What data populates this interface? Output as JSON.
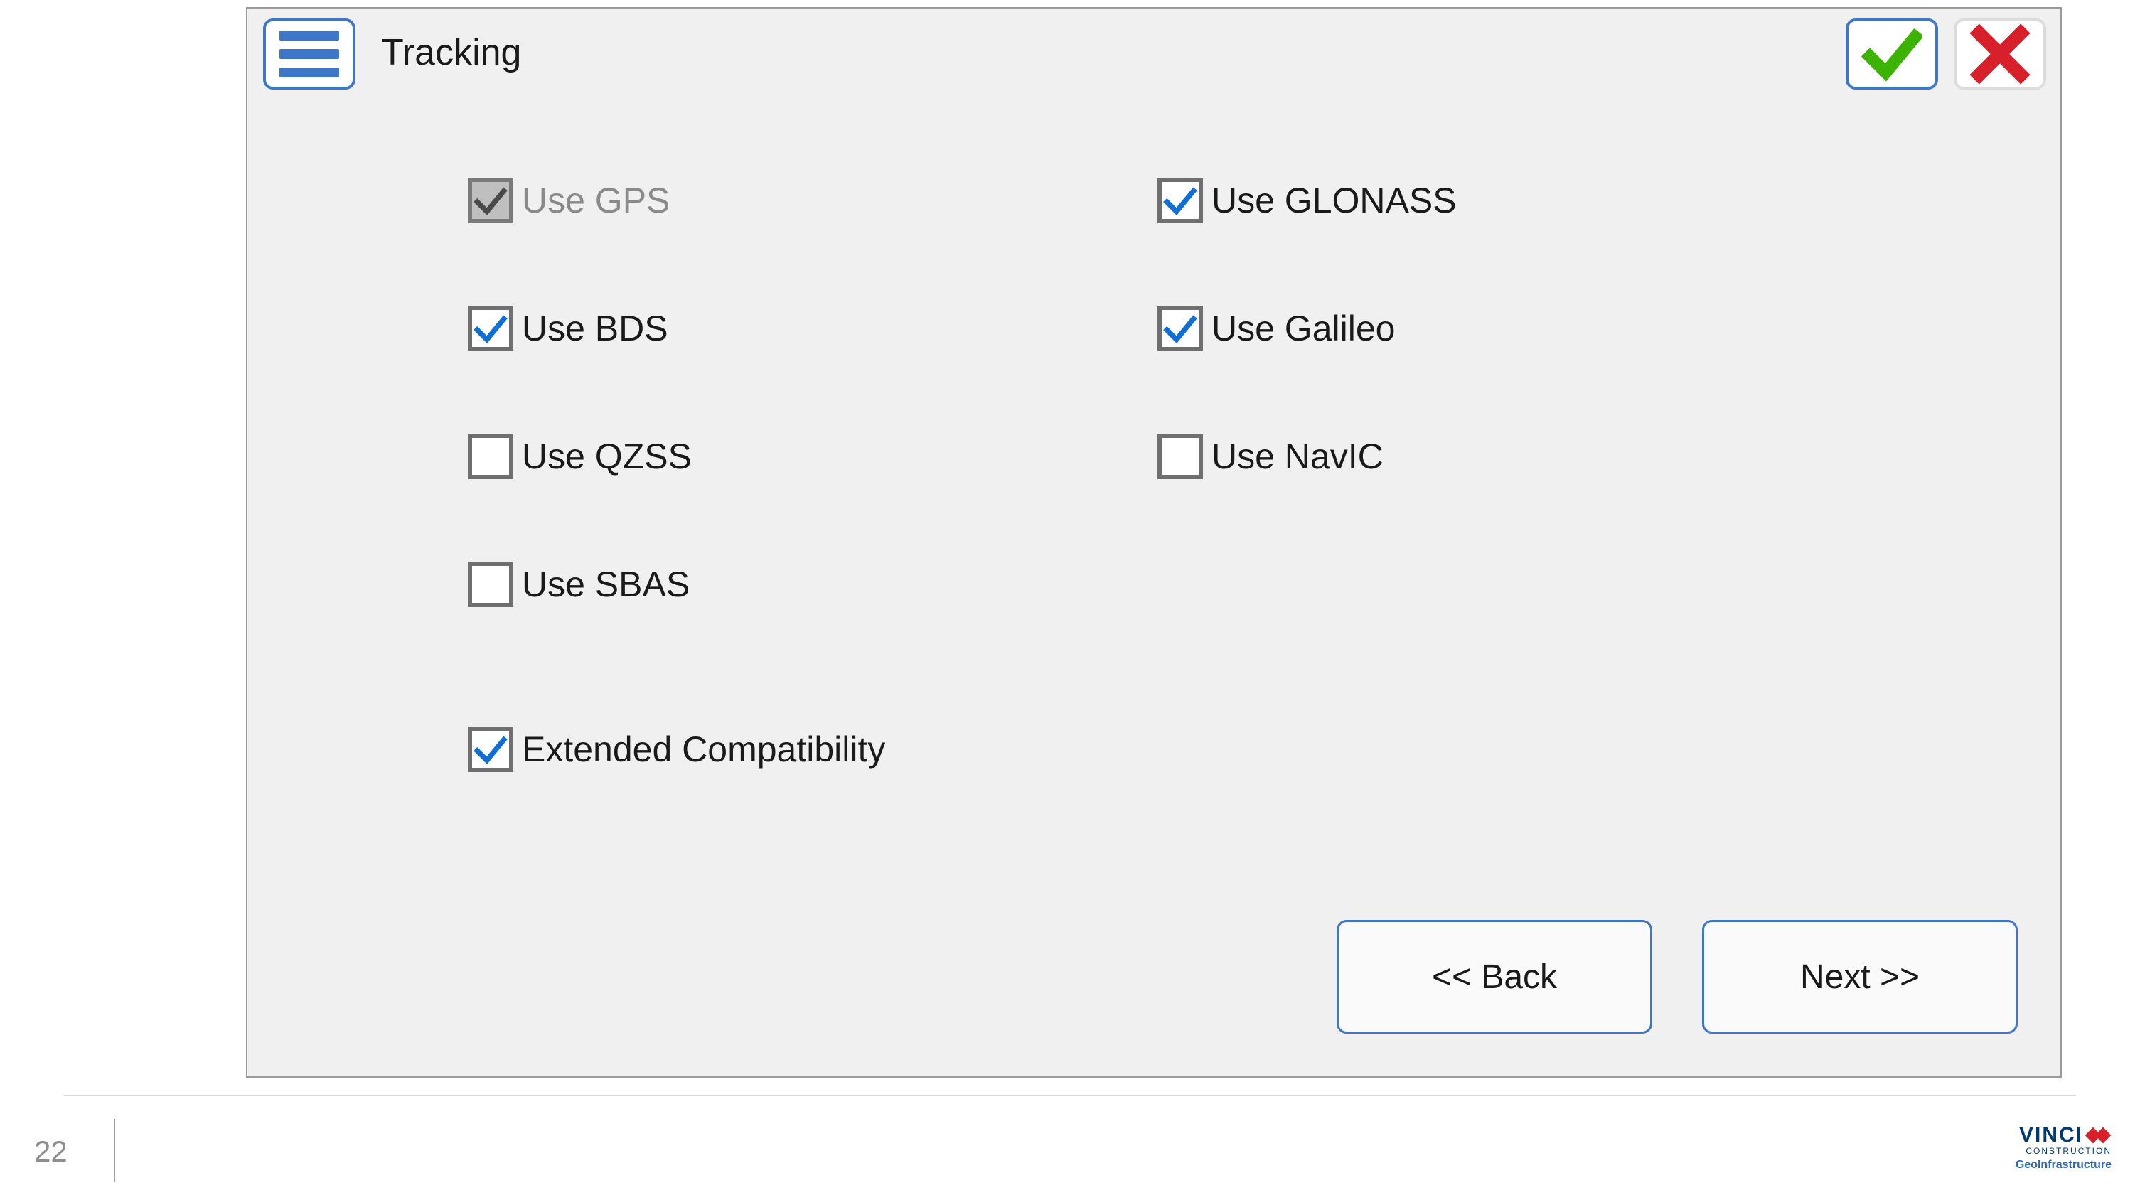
{
  "header": {
    "title": "Tracking"
  },
  "options": {
    "gps": {
      "label": "Use GPS",
      "checked": true,
      "disabled": true
    },
    "glonass": {
      "label": "Use GLONASS",
      "checked": true,
      "disabled": false
    },
    "bds": {
      "label": "Use BDS",
      "checked": true,
      "disabled": false
    },
    "galileo": {
      "label": "Use Galileo",
      "checked": true,
      "disabled": false
    },
    "qzss": {
      "label": "Use QZSS",
      "checked": false,
      "disabled": false
    },
    "navic": {
      "label": "Use NavIC",
      "checked": false,
      "disabled": false
    },
    "sbas": {
      "label": "Use SBAS",
      "checked": false,
      "disabled": false
    },
    "ext": {
      "label": "Extended Compatibility",
      "checked": true,
      "disabled": false
    }
  },
  "nav": {
    "back": "<< Back",
    "next": "Next >>"
  },
  "footer": {
    "page": "22",
    "brand": "VINCI",
    "brand_sub1": "CONSTRUCTION",
    "brand_sub2": "GeoInfrastructure"
  }
}
